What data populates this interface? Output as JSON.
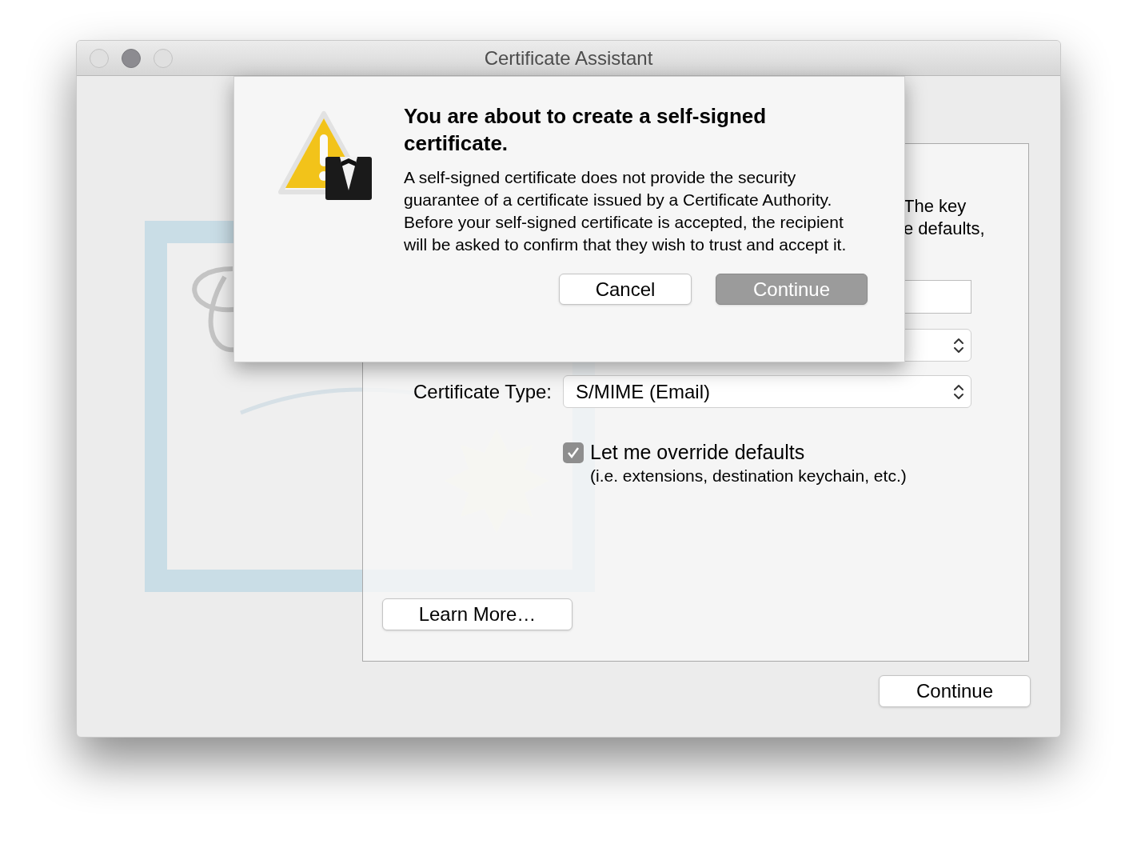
{
  "window": {
    "title": "Certificate Assistant"
  },
  "intro_text": [
    "The key",
    "e defaults,"
  ],
  "certificate_type": {
    "label": "Certificate Type:",
    "value": "S/MIME (Email)"
  },
  "override": {
    "label": "Let me override defaults",
    "note": "(i.e. extensions, destination keychain, etc.)",
    "checked": true
  },
  "learn_more": "Learn More…",
  "footer_button": "Continue",
  "alert": {
    "title": "You are about to create a self-signed certificate.",
    "message": "A self-signed certificate does not provide the security guarantee of a certificate issued by a Certificate Authority. Before your self-signed certificate is accepted, the recipient will be asked to confirm that they wish to trust and accept it.",
    "buttons": [
      {
        "label": "Cancel",
        "kind": "normal"
      },
      {
        "label": "Continue",
        "kind": "default"
      }
    ]
  }
}
